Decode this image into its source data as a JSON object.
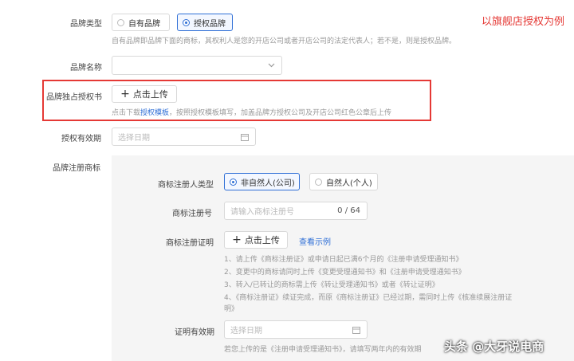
{
  "annotation": {
    "text": "以旗舰店授权为例",
    "color": "#e53935"
  },
  "brand_type": {
    "label": "品牌类型",
    "options": [
      "自有品牌",
      "授权品牌"
    ],
    "selected": "授权品牌",
    "hint": "自有品牌即品牌下面的商标，其权利人是您的开店公司或者开店公司的法定代表人；若不是，则是授权品牌。"
  },
  "brand_name": {
    "label": "品牌名称",
    "value": ""
  },
  "exclusive_auth": {
    "label": "品牌独占授权书",
    "upload_label": "点击上传",
    "hint_prefix": "点击下载",
    "hint_link": "授权模板",
    "hint_suffix": "，按照授权模板填写，加盖品牌方授权公司及开店公司红色公章后上传",
    "highlight_color": "#e53935"
  },
  "auth_validity": {
    "label": "授权有效期",
    "placeholder": "选择日期"
  },
  "trademark": {
    "label": "品牌注册商标",
    "registrant_type": {
      "label": "商标注册人类型",
      "options": [
        "非自然人(公司)",
        "自然人(个人)"
      ],
      "selected": "非自然人(公司)"
    },
    "reg_number": {
      "label": "商标注册号",
      "placeholder": "请输入商标注册号",
      "counter": "0 / 64"
    },
    "certificate": {
      "label": "商标注册证明",
      "upload_label": "点击上传",
      "example_link": "查看示例",
      "notes": [
        "1、请上传《商标注册证》或申请日起已满6个月的《注册申请受理通知书》",
        "2、变更中的商标请同时上传《变更受理通知书》和《注册申请受理通知书》",
        "3、转入/已转让的商标需上传《转让受理通知书》或者《转让证明》",
        "4、《商标注册证》续证完成，而原《商标注册证》已经过期，需同时上传《核准续展注册证",
        "明》"
      ]
    },
    "cert_validity": {
      "label": "证明有效期",
      "placeholder": "选择日期",
      "hint": "若您上传的是《注册申请受理通知书》，请填写两年内的有效期"
    }
  },
  "watermark": "头条 @大牙说电商"
}
